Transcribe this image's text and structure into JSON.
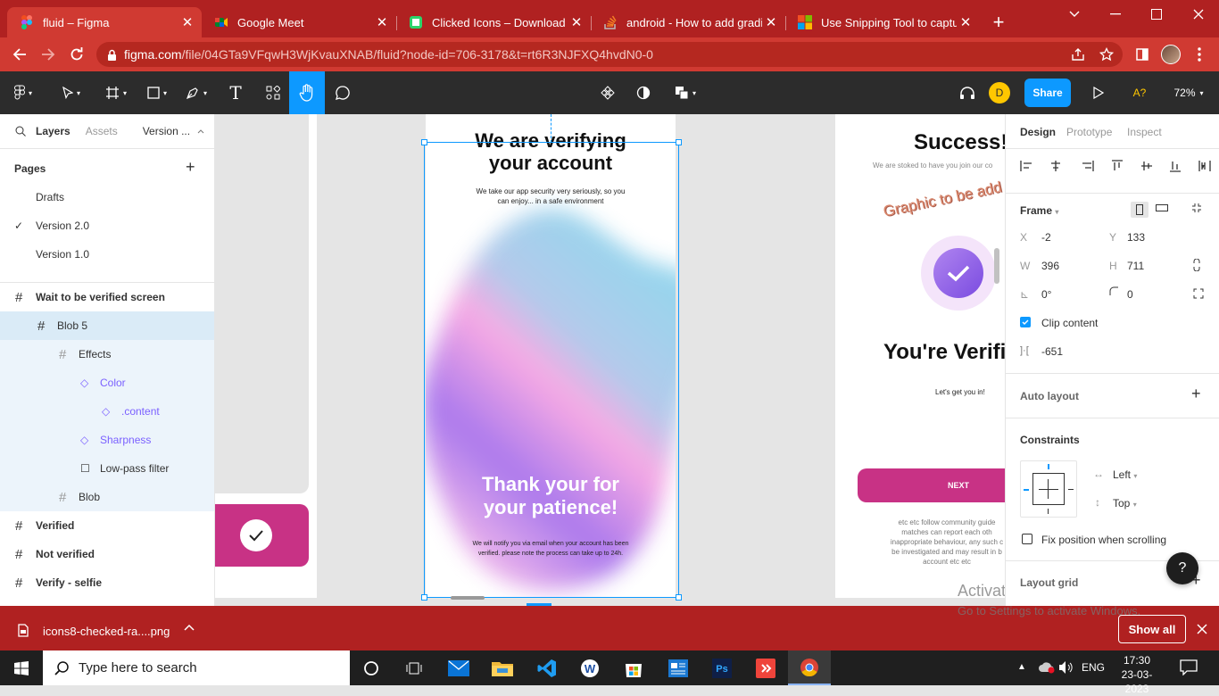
{
  "browser": {
    "tabs": [
      {
        "title": "fluid – Figma",
        "active": true
      },
      {
        "title": "Google Meet",
        "active": false
      },
      {
        "title": "Clicked Icons – Download for",
        "active": false
      },
      {
        "title": "android - How to add gradie",
        "active": false
      },
      {
        "title": "Use Snipping Tool to capture",
        "active": false
      }
    ],
    "url_host": "figma.com",
    "url_path": "/file/04GTa9VFqwH3WjKvauXNAB/fluid?node-id=706-3178&t=rt6R3NJFXQ4hvdN0-0",
    "accent": "#b02121"
  },
  "figma_toolbar": {
    "share_label": "Share",
    "avatar_letter": "D",
    "font_missing": "A?",
    "zoom": "72%"
  },
  "left_panel": {
    "tabs": [
      "Layers",
      "Assets",
      "Version ..."
    ],
    "pages_heading": "Pages",
    "pages": [
      "Drafts",
      "Version 2.0",
      "Version 1.0"
    ],
    "current_page": "Version 2.0",
    "layers": [
      {
        "name": "Wait to be verified screen",
        "level": 0
      },
      {
        "name": "Blob 5",
        "level": 1
      },
      {
        "name": "Effects",
        "level": 2
      },
      {
        "name": "Color",
        "level": 3
      },
      {
        "name": ".content",
        "level": 4
      },
      {
        "name": "Sharpness",
        "level": 3
      },
      {
        "name": "Low-pass filter",
        "level": 3
      },
      {
        "name": "Blob",
        "level": 2
      },
      {
        "name": "Verified",
        "level": 0
      },
      {
        "name": "Not verified",
        "level": 0
      },
      {
        "name": "Verify - selfie",
        "level": 0
      }
    ]
  },
  "canvas": {
    "frame_main": {
      "title_line1": "We are verifying",
      "title_line2": "your account",
      "sub_line1": "We take our app security very seriously, so you",
      "sub_line2": "can enjoy... in a safe environment",
      "thanks_line1": "Thank your for",
      "thanks_line2": "your patience!",
      "note_line1": "We will notify you via email when your account has been",
      "note_line2": "verified. please note the process can take up to 24h."
    },
    "frame_right": {
      "title": "Success!",
      "sub": "We are stoked to have you join our co",
      "graphic_note": "Graphic to be add",
      "verified_title": "You're Verifi",
      "get_in": "Let's get you in!",
      "next_label": "NEXT",
      "fine_lines": [
        "etc etc follow community guide",
        "matches can report each oth",
        "inappropriate behaviour, any such c",
        "be investigated and may result in b",
        "account etc etc"
      ]
    },
    "watermark_title": "Activate Windows",
    "watermark_sub": "Go to Settings to activate Windows."
  },
  "right_panel": {
    "tabs": [
      "Design",
      "Prototype",
      "Inspect"
    ],
    "frame_label": "Frame",
    "x": "-2",
    "y": "133",
    "w": "396",
    "h": "711",
    "rotation": "0°",
    "radius": "0",
    "clip_label": "Clip content",
    "spacing": "-651",
    "auto_layout": "Auto layout",
    "constraints": "Constraints",
    "h_constraint": "Left",
    "v_constraint": "Top",
    "fix_label": "Fix position when scrolling",
    "layout_grid": "Layout grid",
    "help": "?"
  },
  "downloads": {
    "file": "icons8-checked-ra....png",
    "show_all": "Show all"
  },
  "taskbar": {
    "search_placeholder": "Type here to search",
    "lang": "ENG",
    "time": "17:30",
    "date": "23-03-2023"
  }
}
